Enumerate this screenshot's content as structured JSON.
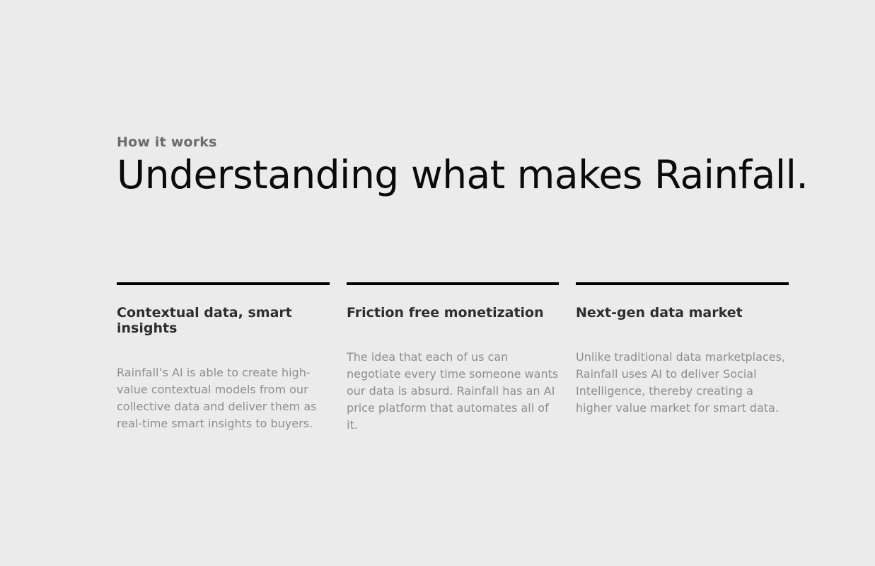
{
  "eyebrow": "How it works",
  "headline": "Understanding what makes Rainfall.",
  "features": [
    {
      "title": "Contextual data, smart insights",
      "body": "Rainfall’s AI is able to create high-value contextual models from our collective data and deliver them as real-time smart insights to buyers."
    },
    {
      "title": "Friction free monetization",
      "body": "The idea that each of us can negotiate every time someone wants our data is absurd. Rainfall has an AI price platform that automates all of it."
    },
    {
      "title": "Next-gen data market",
      "body": "Unlike traditional data marketplaces, Rainfall uses AI to deliver Social Intelligence, thereby creating a higher value market for smart data."
    }
  ],
  "colors": {
    "background": "#ebebeb",
    "headline": "#0a0a0a",
    "eyebrow": "#6b6b6b",
    "feature_title": "#2e2e2e",
    "feature_body": "#8e8e8e",
    "divider": "#000000"
  }
}
